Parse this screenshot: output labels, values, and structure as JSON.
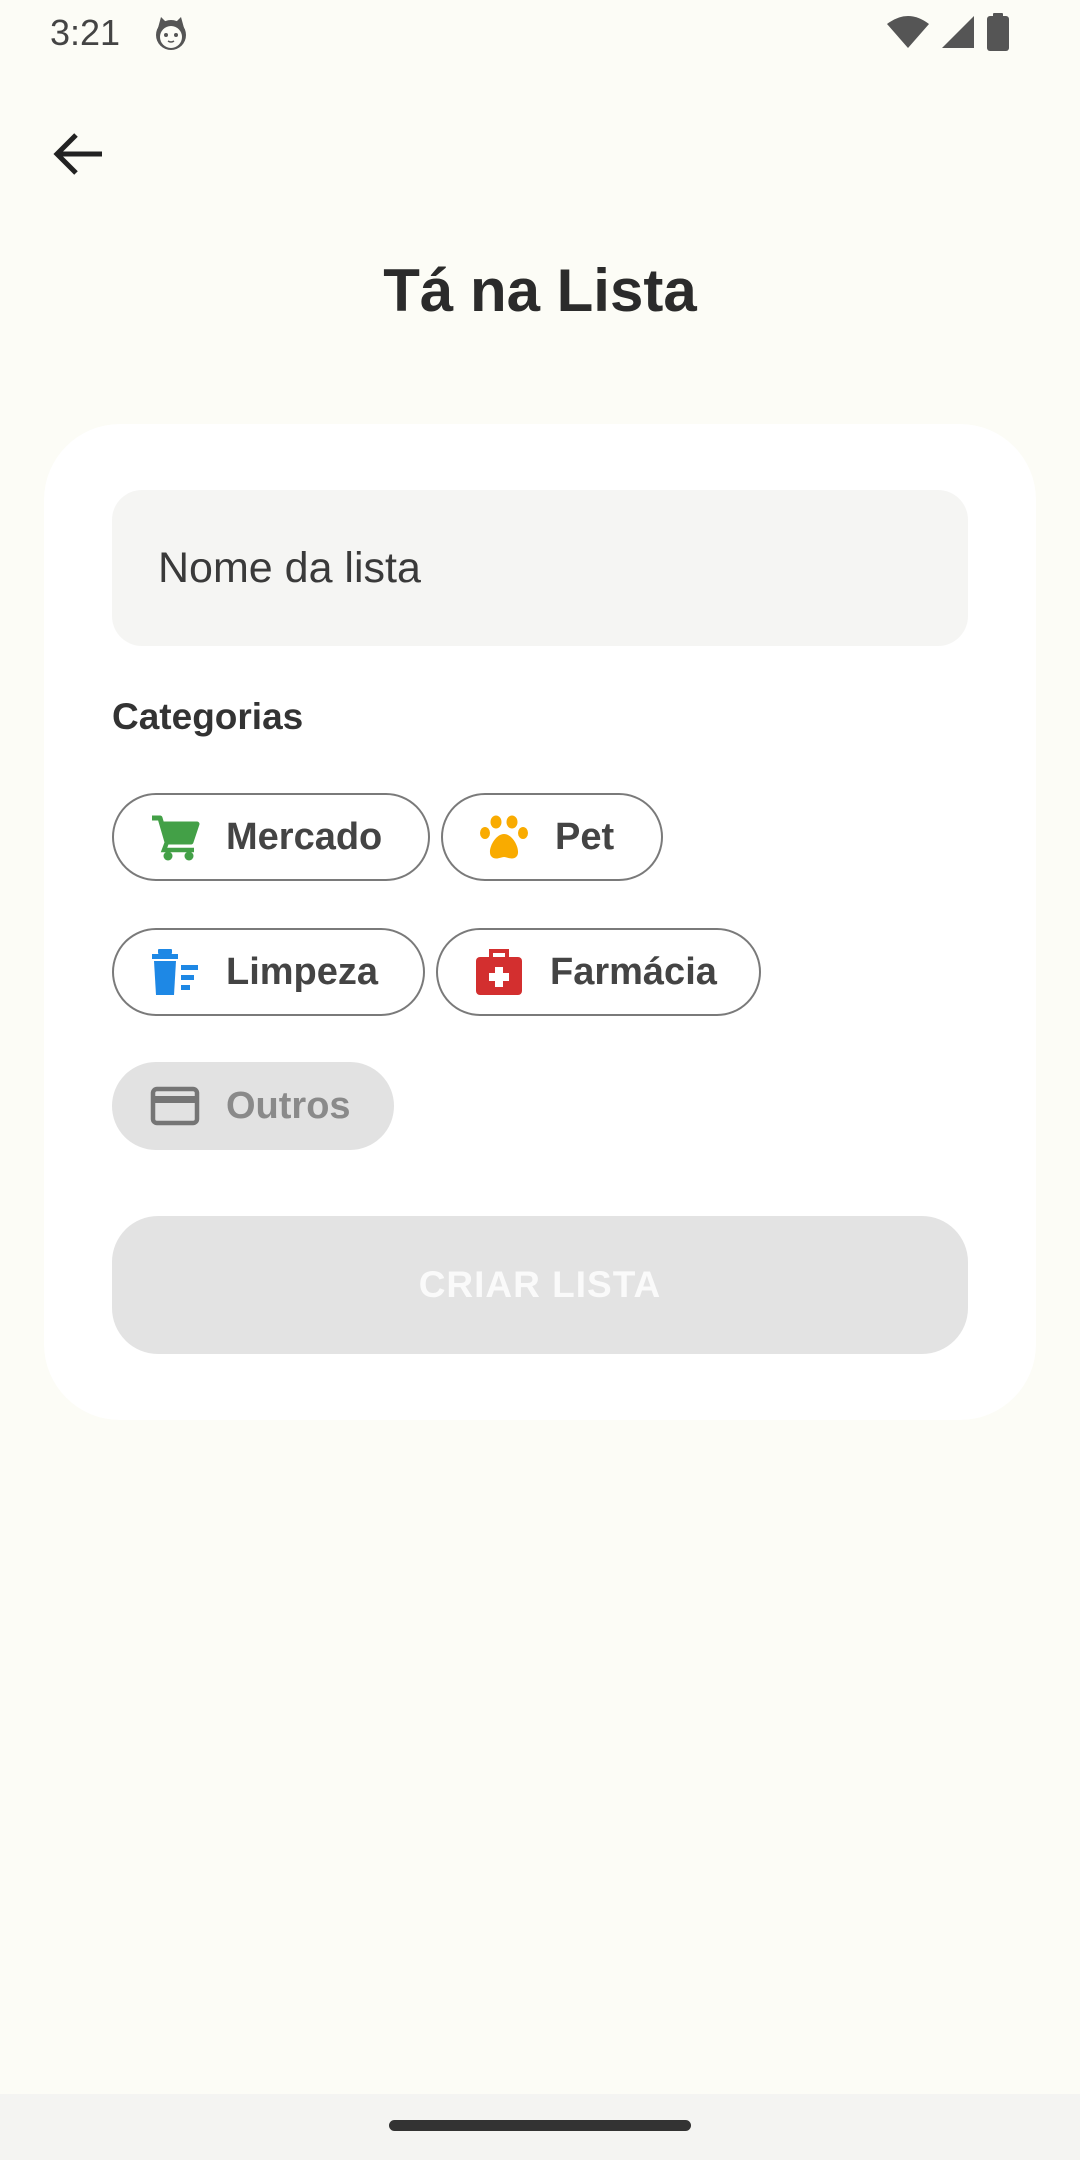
{
  "status_bar": {
    "time": "3:21",
    "notification_icon": "cat-icon",
    "icons": [
      "wifi-icon",
      "signal-icon",
      "battery-icon"
    ]
  },
  "header": {
    "back_icon": "arrow-back-icon",
    "title": "Tá na Lista"
  },
  "form": {
    "name_placeholder": "Nome da lista",
    "name_value": "",
    "categories_label": "Categorias",
    "categories": [
      {
        "label": "Mercado",
        "icon": "shopping-cart-icon",
        "color": "#43a047",
        "selected": false
      },
      {
        "label": "Pet",
        "icon": "paw-icon",
        "color": "#f9ab00",
        "selected": false
      },
      {
        "label": "Limpeza",
        "icon": "cleaning-bin-icon",
        "color": "#1e88e5",
        "selected": false
      },
      {
        "label": "Farmácia",
        "icon": "medical-kit-icon",
        "color": "#d32f2f",
        "selected": false
      },
      {
        "label": "Outros",
        "icon": "credit-card-icon",
        "color": "#757575",
        "selected": true
      }
    ],
    "create_button_label": "CRIAR LISTA",
    "create_button_enabled": false
  },
  "colors": {
    "background": "#fcfcf6",
    "card": "#ffffff",
    "chip_border": "#7a7a7a",
    "disabled_button": "#e3e3e3"
  }
}
